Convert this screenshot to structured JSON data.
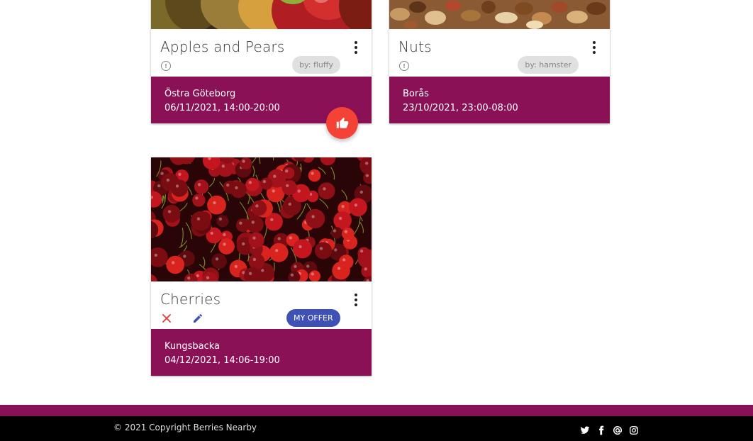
{
  "cards": [
    {
      "title": "Apples and Pears",
      "author_chip": "by: fluffy",
      "location": "Östra Göteborg",
      "time": "06/11/2021, 14:00-20:00"
    },
    {
      "title": "Nuts",
      "author_chip": "by: hamster",
      "location": "Borås",
      "time": "23/10/2021, 23:00-08:00"
    },
    {
      "title": "Cherries",
      "offer_chip": "MY OFFER",
      "location": "Kungsbacka",
      "time": "04/12/2021, 14:06-19:00"
    }
  ],
  "icons": {
    "more": "more-vert-icon",
    "info": "info-icon",
    "like": "thumb-up-icon",
    "delete": "close-icon",
    "edit": "pencil-icon",
    "social": [
      "twitter-icon",
      "facebook-icon",
      "at-sign-icon",
      "instagram-icon"
    ]
  },
  "footer": {
    "copyright": "© 2021 Copyright Berries Nearby"
  },
  "colors": {
    "card_footer": "#8b1157",
    "like_button": "#f44336",
    "my_offer_chip": "#3f51b5",
    "delete_icon": "#e53935",
    "edit_icon": "#3f51b5"
  }
}
